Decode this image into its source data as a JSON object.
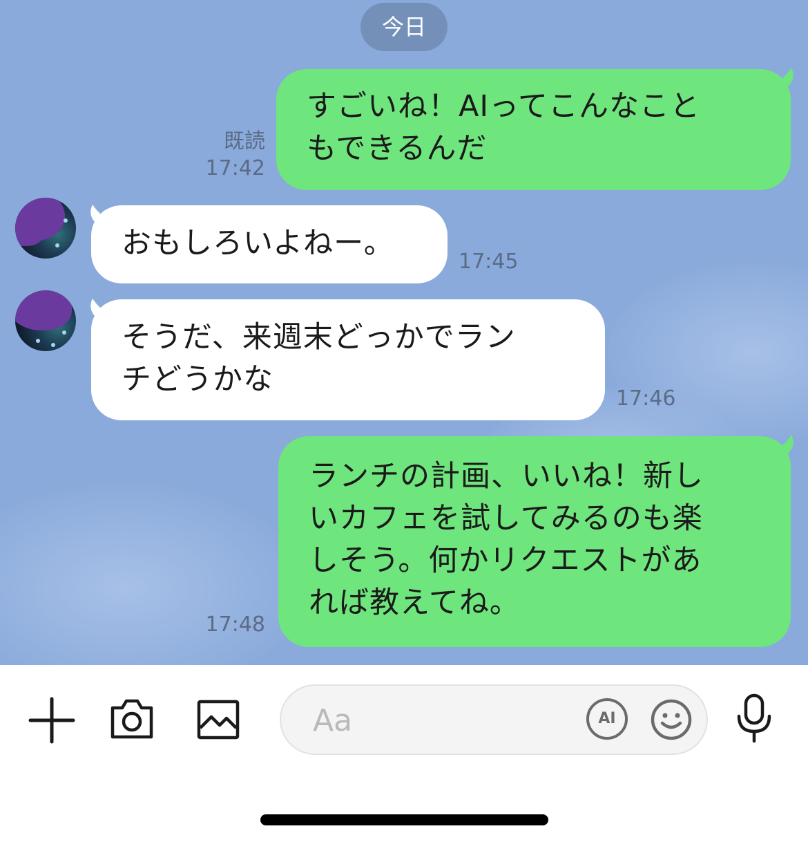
{
  "date_separator": "今日",
  "messages": [
    {
      "direction": "outgoing",
      "lines": [
        "すごいね！AIってこんなこと",
        "もできるんだ"
      ],
      "read_label": "既読",
      "time": "17:42"
    },
    {
      "direction": "incoming",
      "lines": [
        "おもしろいよねー。"
      ],
      "time": "17:45"
    },
    {
      "direction": "incoming",
      "lines": [
        "そうだ、来週末どっかでラン",
        "チどうかな"
      ],
      "time": "17:46"
    },
    {
      "direction": "outgoing",
      "lines": [
        "ランチの計画、いいね！新し",
        "いカフェを試してみるのも楽",
        "しそう。何かリクエストがあ",
        "れば教えてね。"
      ],
      "time": "17:48"
    }
  ],
  "input_bar": {
    "placeholder": "Aa",
    "ai_label": "AI",
    "icons": [
      "plus-icon",
      "camera-icon",
      "image-icon",
      "ai-icon",
      "emoji-icon",
      "microphone-icon"
    ]
  },
  "colors": {
    "chat_background": "#8aaadb",
    "outgoing_bubble": "#6fe57d",
    "incoming_bubble": "#ffffff",
    "date_pill": "#7590b8"
  }
}
